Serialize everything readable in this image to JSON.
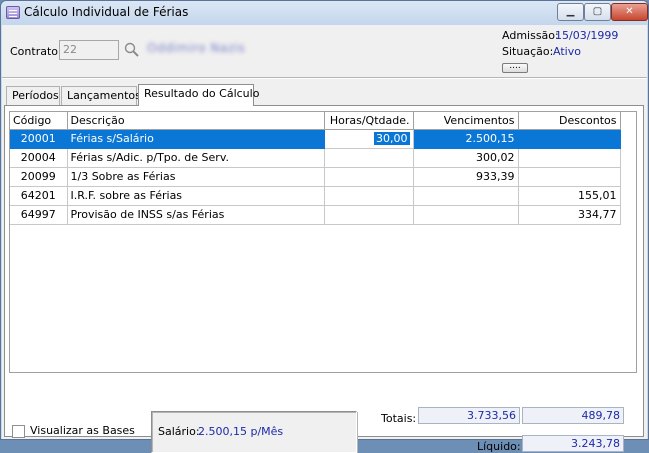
{
  "window": {
    "title": "Cálculo Individual de Férias",
    "controls": {
      "minimize": "▁",
      "maximize": "▢",
      "close": "✕"
    }
  },
  "header": {
    "contrato_label": "Contrato:",
    "contrato_value": "22",
    "employee_name": "Oddimiro Nazis",
    "admissao_label": "Admissão:",
    "admissao_value": "15/03/1999",
    "situacao_label": "Situação:",
    "situacao_value": "Ativo",
    "more_button": "...."
  },
  "tabs": [
    {
      "label": "Períodos"
    },
    {
      "label": "Lançamentos"
    },
    {
      "label": "Resultado do Cálculo"
    }
  ],
  "grid": {
    "columns": [
      "Código",
      "Descrição",
      "Horas/Qtdade.",
      "Vencimentos",
      "Descontos"
    ],
    "rows": [
      {
        "codigo": "20001",
        "descricao": "Férias s/Salário",
        "horas": "30,00",
        "vencimentos": "2.500,15",
        "descontos": ""
      },
      {
        "codigo": "20004",
        "descricao": "Férias s/Adic. p/Tpo. de Serv.",
        "horas": "",
        "vencimentos": "300,02",
        "descontos": ""
      },
      {
        "codigo": "20099",
        "descricao": "1/3 Sobre as Férias",
        "horas": "",
        "vencimentos": "933,39",
        "descontos": ""
      },
      {
        "codigo": "64201",
        "descricao": "I.R.F. sobre as Férias",
        "horas": "",
        "vencimentos": "",
        "descontos": "155,01"
      },
      {
        "codigo": "64997",
        "descricao": "Provisão de INSS s/as Férias",
        "horas": "",
        "vencimentos": "",
        "descontos": "334,77"
      }
    ]
  },
  "footer": {
    "visualizar_label": "Visualizar as Bases",
    "salario_label": "Salário:",
    "salario_value": "2.500,15 p/Mês",
    "totais_label": "Totais:",
    "total_vencimentos": "3.733,56",
    "total_descontos": "489,78",
    "liquido_label": "Líquido:",
    "liquido_value": "3.243,78"
  },
  "colors": {
    "selection": "#0a77d6",
    "value_blue": "#1c2aa8"
  }
}
